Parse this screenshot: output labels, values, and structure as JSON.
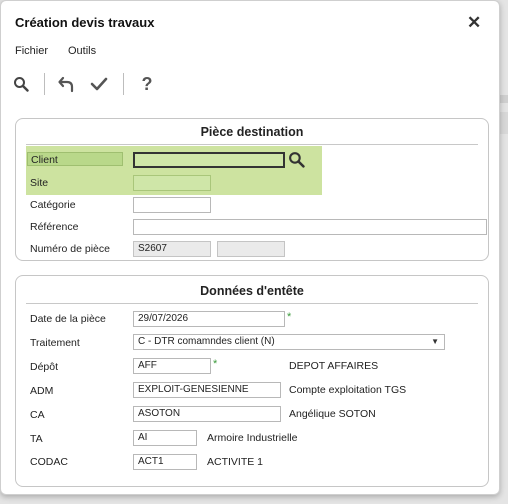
{
  "dialog": {
    "title": "Création devis travaux",
    "close_symbol": "✕"
  },
  "menu": {
    "items": [
      "Fichier",
      "Outils"
    ]
  },
  "toolbar": {
    "search_icon": "search-icon",
    "undo_icon": "undo-icon",
    "check_icon": "check-icon",
    "help_label": "?"
  },
  "piece_destination": {
    "title": "Pièce destination",
    "client": {
      "label": "Client",
      "value": ""
    },
    "site": {
      "label": "Site",
      "value": ""
    },
    "categorie": {
      "label": "Catégorie",
      "value": ""
    },
    "reference": {
      "label": "Référence",
      "value": ""
    },
    "numero": {
      "label": "Numéro de pièce",
      "value": "S2607",
      "value2": ""
    }
  },
  "donnees_entete": {
    "title": "Données d'entête",
    "date": {
      "label": "Date de la pièce",
      "value": "29/07/2026",
      "required": "*"
    },
    "traitement": {
      "label": "Traitement",
      "value": "C  - DTR comamndes client (N)"
    },
    "depot": {
      "label": "Dépôt",
      "value": "AFF",
      "required": "*",
      "desc": "DEPOT AFFAIRES"
    },
    "adm": {
      "label": "ADM",
      "value": "EXPLOIT-GENESIENNE",
      "desc": "Compte exploitation TGS"
    },
    "ca": {
      "label": "CA",
      "value": "ASOTON",
      "desc": "Angélique SOTON"
    },
    "ta": {
      "label": "TA",
      "value": "AI",
      "desc": "Armoire Industrielle"
    },
    "codac": {
      "label": "CODAC",
      "value": "ACT1",
      "desc": "ACTIVITE 1"
    }
  },
  "colors": {
    "highlight": "#cde3a0",
    "required_star": "#3a9a3a"
  }
}
